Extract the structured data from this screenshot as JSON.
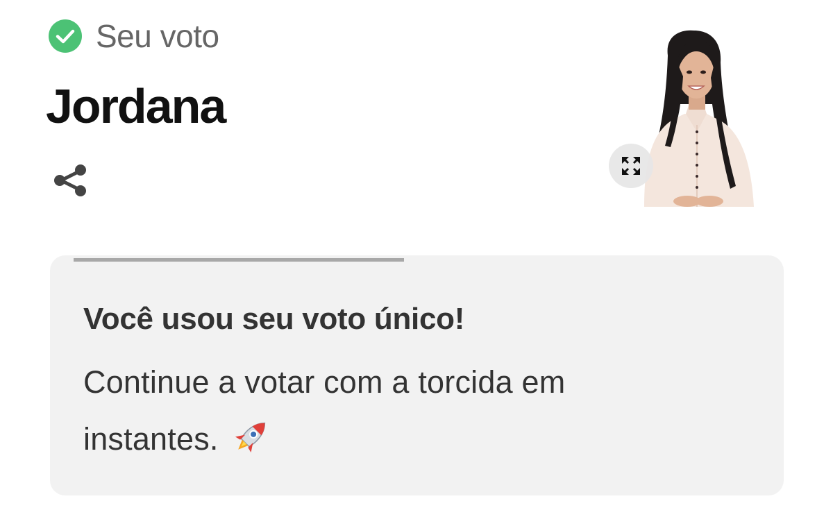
{
  "vote": {
    "status_icon": "check-circle-icon",
    "label": "Seu voto",
    "accent_color": "#4cc275"
  },
  "candidate": {
    "name": "Jordana",
    "share_icon": "share-icon",
    "photo_icon": "candidate-photo",
    "expand_icon": "expand-icon"
  },
  "message_card": {
    "progress_fraction": 0.45,
    "title": "Você usou seu voto único!",
    "body": "Continue a votar com a torcida em instantes.",
    "emoji_icon": "rocket-icon"
  }
}
